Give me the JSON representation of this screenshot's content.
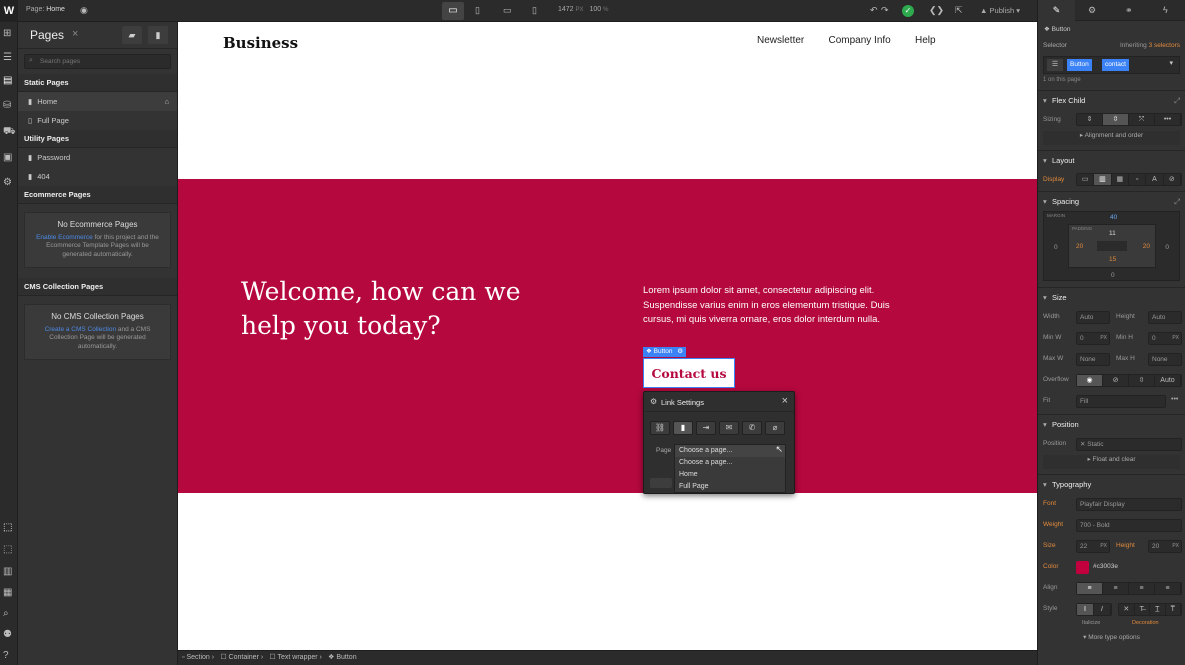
{
  "topbar": {
    "logo": "W",
    "page_label": "Page:",
    "page_name": "Home",
    "width_value": "1472",
    "width_unit": "PX",
    "zoom_value": "100",
    "zoom_unit": "%",
    "publish_label": "Publish"
  },
  "pages_panel": {
    "title": "Pages",
    "search_placeholder": "Search pages",
    "static_header": "Static Pages",
    "static_pages": [
      "Home",
      "Full Page"
    ],
    "utility_header": "Utility Pages",
    "utility_pages": [
      "Password",
      "404"
    ],
    "ecommerce_header": "Ecommerce Pages",
    "ecommerce_empty_title": "No Ecommerce Pages",
    "ecommerce_link": "Enable Ecommerce",
    "ecommerce_text": "for this project and the Ecommerce Template Pages will be generated automatically.",
    "cms_header": "CMS Collection Pages",
    "cms_empty_title": "No CMS Collection Pages",
    "cms_link": "Create a CMS Collection",
    "cms_text": "and a CMS Collection Page will be generated automatically."
  },
  "site": {
    "brand": "Business",
    "nav": [
      "Newsletter",
      "Company Info",
      "Help"
    ],
    "heading": "Welcome, how can we help you today?",
    "paragraph": "Lorem ipsum dolor sit amet, consectetur adipiscing elit. Suspendisse varius enim in eros elementum tristique. Duis cursus, mi quis viverra ornare, eros dolor interdum nulla.",
    "button_tag": "Button",
    "button_label": "Contact us",
    "hero_color": "#b4083e",
    "accent_color": "#c3003e"
  },
  "link_settings": {
    "title": "Link Settings",
    "page_label": "Page",
    "selected": "Choose a page...",
    "options": [
      "Choose a page...",
      "Home",
      "Full Page"
    ]
  },
  "breadcrumbs": [
    "Section",
    "Container",
    "Text wrapper",
    "Button"
  ],
  "right_panel": {
    "element_type": "Button",
    "selector_label": "Selector",
    "inheriting_label": "Inheriting",
    "inheriting_count": "3 selectors",
    "selector_tags": [
      "Button",
      "contact"
    ],
    "on_page": "1 on this page",
    "flex_child": "Flex Child",
    "sizing_label": "Sizing",
    "alignment_order": "Alignment and order",
    "layout": "Layout",
    "display_label": "Display",
    "spacing": "Spacing",
    "margin_label": "MARGIN",
    "padding_label": "PADDING",
    "margin_top": "40",
    "margin_left": "0",
    "margin_right": "0",
    "margin_bottom": "0",
    "padding_top": "11",
    "padding_left": "20",
    "padding_right": "20",
    "padding_bottom": "15",
    "size": "Size",
    "width_label": "Width",
    "width_value": "Auto",
    "height_label": "Height",
    "height_value": "Auto",
    "minw_label": "Min W",
    "minw_value": "0",
    "minh_label": "Min H",
    "minh_value": "0",
    "px": "PX",
    "maxw_label": "Max W",
    "maxw_value": "None",
    "maxh_label": "Max H",
    "maxh_value": "None",
    "overflow_label": "Overflow",
    "overflow_auto": "Auto",
    "fit_label": "Fit",
    "fit_value": "Fill",
    "position": "Position",
    "position_label": "Position",
    "position_value": "Static",
    "float_clear": "Float and clear",
    "typography": "Typography",
    "font_label": "Font",
    "font_value": "Playfair Display",
    "weight_label": "Weight",
    "weight_value": "700 - Bold",
    "size_label": "Size",
    "size_value": "22",
    "height_t_label": "Height",
    "height_t_value": "20",
    "color_label": "Color",
    "color_value": "#c3003e",
    "align_label": "Align",
    "style_label": "Style",
    "italicize": "Italicize",
    "decoration": "Decoration",
    "more_type": "More type options"
  }
}
